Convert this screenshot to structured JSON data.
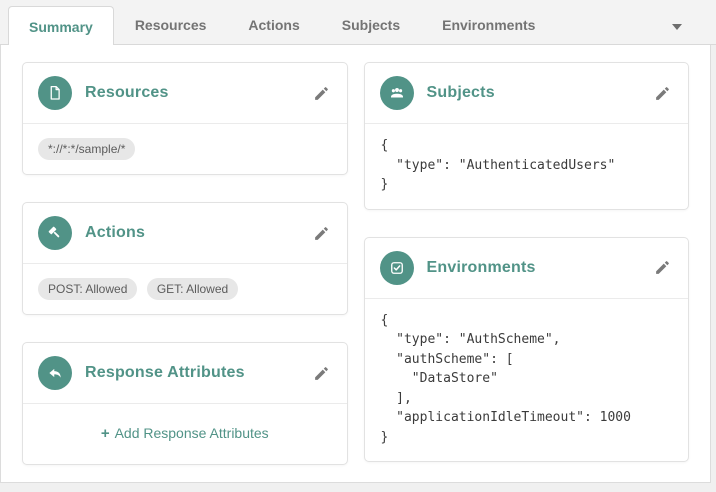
{
  "colors": {
    "accent_teal": "#519387",
    "tab_inactive_text": "#747474",
    "badge_background": "#e7e7e7",
    "panel_border": "#dcdcdc"
  },
  "tabbar": {
    "active_tab": "Summary",
    "tabs": [
      {
        "label": "Summary"
      },
      {
        "label": "Resources"
      },
      {
        "label": "Actions"
      },
      {
        "label": "Subjects"
      },
      {
        "label": "Environments"
      }
    ],
    "overflow_icon": "chevron-down-icon"
  },
  "cards": {
    "resources": {
      "title": "Resources",
      "icon": "file-icon",
      "edit_icon": "pencil-icon",
      "badges": [
        "*://*:*/sample/*"
      ]
    },
    "actions": {
      "title": "Actions",
      "icon": "gavel-icon",
      "edit_icon": "pencil-icon",
      "badges": [
        "POST: Allowed",
        "GET: Allowed"
      ]
    },
    "response_attributes": {
      "title": "Response Attributes",
      "icon": "reply-arrow-icon",
      "edit_icon": "pencil-icon",
      "plus": "+",
      "add_label": "Add Response Attributes"
    },
    "subjects": {
      "title": "Subjects",
      "icon": "users-icon",
      "edit_icon": "pencil-icon",
      "json": "{\n  \"type\": \"AuthenticatedUsers\"\n}"
    },
    "environments": {
      "title": "Environments",
      "icon": "checkbox-checked-icon",
      "edit_icon": "pencil-icon",
      "json": "{\n  \"type\": \"AuthScheme\",\n  \"authScheme\": [\n    \"DataStore\"\n  ],\n  \"applicationIdleTimeout\": 1000\n}"
    }
  }
}
